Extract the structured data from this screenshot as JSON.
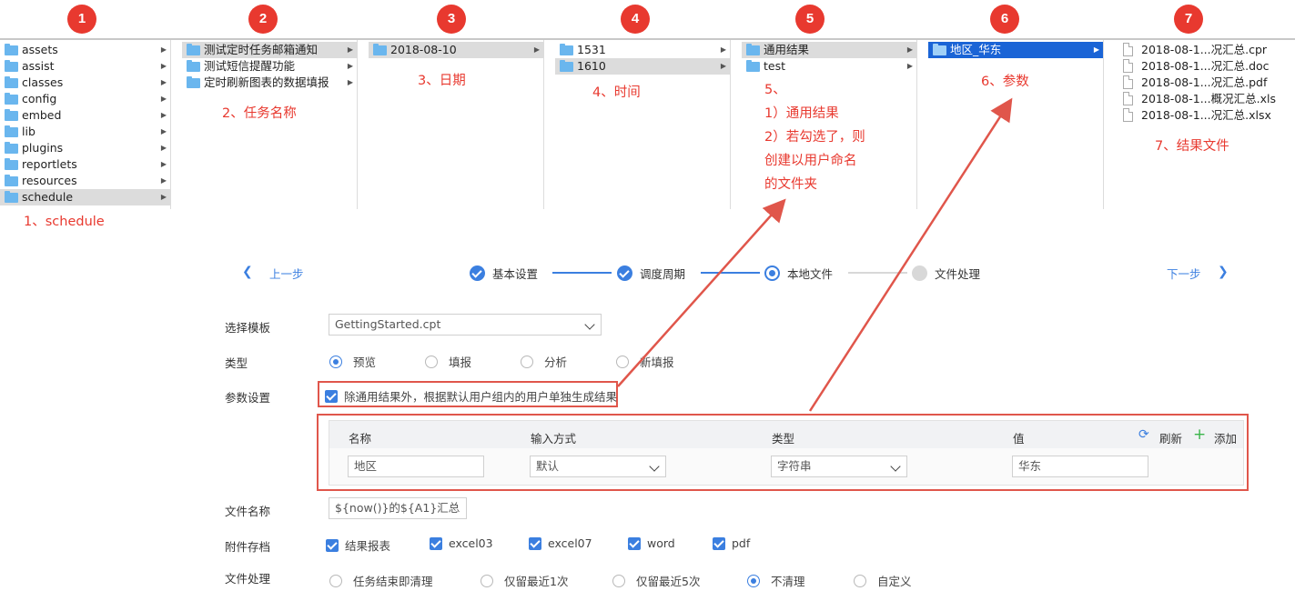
{
  "badges": [
    "1",
    "2",
    "3",
    "4",
    "5",
    "6",
    "7"
  ],
  "finder": {
    "col1": [
      "assets",
      "assist",
      "classes",
      "config",
      "embed",
      "lib",
      "plugins",
      "reportlets",
      "resources",
      "schedule"
    ],
    "col2": [
      "测试定时任务邮箱通知",
      "测试短信提醒功能",
      "定时刷新图表的数据填报"
    ],
    "col3": [
      "2018-08-10"
    ],
    "col4": [
      "1531",
      "1610"
    ],
    "col5": [
      "通用结果",
      "test"
    ],
    "col6": [
      "地区_华东"
    ],
    "col7": [
      "2018-08-1...况汇总.cpr",
      "2018-08-1...况汇总.doc",
      "2018-08-1...况汇总.pdf",
      "2018-08-1...概况汇总.xls",
      "2018-08-1...况汇总.xlsx"
    ]
  },
  "notes": {
    "n1": "1、schedule",
    "n2": "2、任务名称",
    "n3": "3、日期",
    "n4": "4、时间",
    "n5": [
      "5、",
      "1）通用结果",
      "2）若勾选了，则",
      "创建以用户命名",
      "的文件夹"
    ],
    "n6": "6、参数",
    "n7": "7、结果文件"
  },
  "wizard": {
    "prev": "上一步",
    "next": "下一步",
    "steps": [
      "基本设置",
      "调度周期",
      "本地文件",
      "文件处理"
    ],
    "step_states": [
      "done",
      "done",
      "current",
      "todo"
    ],
    "colors": {
      "accent": "#3b7fe0",
      "annotation": "#e8392f"
    }
  },
  "form": {
    "template_label": "选择模板",
    "template_value": "GettingStarted.cpt",
    "type_label": "类型",
    "type_options": [
      "预览",
      "填报",
      "分析",
      "新填报"
    ],
    "type_selected": "预览",
    "param_label": "参数设置",
    "param_checkbox": "除通用结果外，根据默认用户组内的用户单独生成结果",
    "param_table": {
      "headers": [
        "名称",
        "输入方式",
        "类型",
        "值"
      ],
      "refresh": "刷新",
      "add": "添加",
      "row": {
        "name": "地区",
        "input": "默认",
        "type": "字符串",
        "value": "华东"
      }
    },
    "filename_label": "文件名称",
    "filename_value": "${now()}的${A1}汇总",
    "attach_label": "附件存档",
    "attach_options": [
      "结果报表",
      "excel03",
      "excel07",
      "word",
      "pdf"
    ],
    "process_label": "文件处理",
    "process_options": [
      "任务结束即清理",
      "仅留最近1次",
      "仅留最近5次",
      "不清理",
      "自定义"
    ],
    "process_selected": "不清理"
  }
}
